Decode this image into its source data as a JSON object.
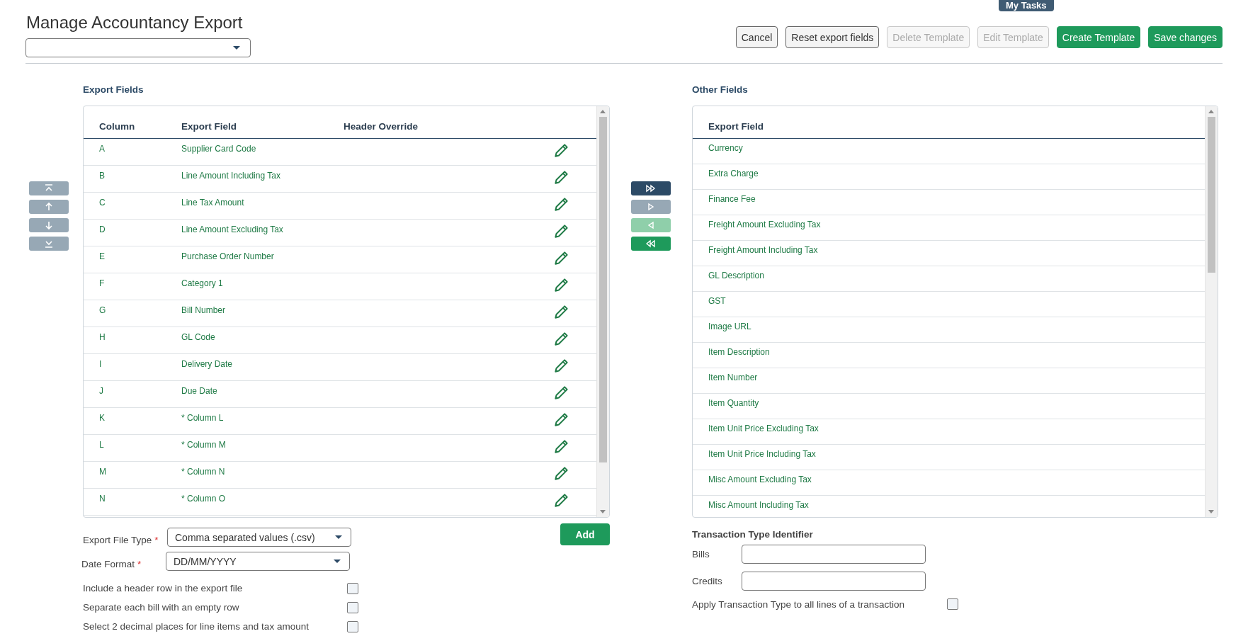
{
  "title": "Manage Accountancy Export",
  "my_tasks_button": "My Tasks",
  "actions": [
    {
      "label": "Cancel",
      "kind": "default",
      "disabled": false
    },
    {
      "label": "Reset export fields",
      "kind": "default",
      "disabled": false
    },
    {
      "label": "Delete Template",
      "kind": "default",
      "disabled": true
    },
    {
      "label": "Edit Template",
      "kind": "default",
      "disabled": true
    },
    {
      "label": "Create Template",
      "kind": "primary",
      "disabled": false
    },
    {
      "label": "Save changes",
      "kind": "primary",
      "disabled": false
    }
  ],
  "order_buttons": [
    {
      "kind": "top",
      "disabled": true
    },
    {
      "kind": "up",
      "disabled": true
    },
    {
      "kind": "down",
      "disabled": true
    },
    {
      "kind": "bottom",
      "disabled": true
    }
  ],
  "export_fields": {
    "title": "Export Fields",
    "columns": [
      "Column",
      "Export Field",
      "Header Override"
    ],
    "rows": [
      {
        "column": "A",
        "field": "Supplier Card Code"
      },
      {
        "column": "B",
        "field": "Line Amount Including Tax"
      },
      {
        "column": "C",
        "field": "Line Tax Amount"
      },
      {
        "column": "D",
        "field": "Line Amount Excluding Tax"
      },
      {
        "column": "E",
        "field": "Purchase Order Number"
      },
      {
        "column": "F",
        "field": "Category 1"
      },
      {
        "column": "G",
        "field": "Bill Number"
      },
      {
        "column": "H",
        "field": "GL Code"
      },
      {
        "column": "I",
        "field": "Delivery Date"
      },
      {
        "column": "J",
        "field": "Due Date"
      },
      {
        "column": "K",
        "field": "* Column L"
      },
      {
        "column": "L",
        "field": "* Column M"
      },
      {
        "column": "M",
        "field": "* Column N"
      },
      {
        "column": "N",
        "field": "* Column O"
      }
    ]
  },
  "transfer_buttons": [
    {
      "kind": "all_right",
      "disabled": false
    },
    {
      "kind": "right",
      "disabled": true
    },
    {
      "kind": "left",
      "disabled": true
    },
    {
      "kind": "all_left",
      "disabled": false
    }
  ],
  "other_fields": {
    "title": "Other Fields",
    "column": "Export Field",
    "rows": [
      "Currency",
      "Extra Charge",
      "Finance Fee",
      "Freight Amount Excluding Tax",
      "Freight Amount Including Tax",
      "GL Description",
      "GST",
      "Image URL",
      "Item Description",
      "Item Number",
      "Item Quantity",
      "Item Unit Price Excluding Tax",
      "Item Unit Price Including Tax",
      "Misc Amount Excluding Tax",
      "Misc Amount Including Tax"
    ]
  },
  "add_button": "Add",
  "export_options": {
    "selects": [
      {
        "label": "Export File Type",
        "required_mark": "*",
        "value": "Comma separated values (.csv)"
      },
      {
        "label": "Date Format",
        "required_mark": "*",
        "value": "DD/MM/YYYY"
      }
    ],
    "checkboxes": [
      {
        "label": "Include a header row in the export file",
        "checked": false
      },
      {
        "label": "Separate each bill with an empty row",
        "checked": false
      },
      {
        "label": "Select 2 decimal places for line items and tax amount",
        "checked": false
      }
    ]
  },
  "transaction_type": {
    "title": "Transaction Type Identifier",
    "fields": [
      {
        "label": "Bills"
      },
      {
        "label": "Credits"
      }
    ],
    "apply": {
      "label": "Apply Transaction Type to all lines of a transaction",
      "checked": false
    }
  }
}
